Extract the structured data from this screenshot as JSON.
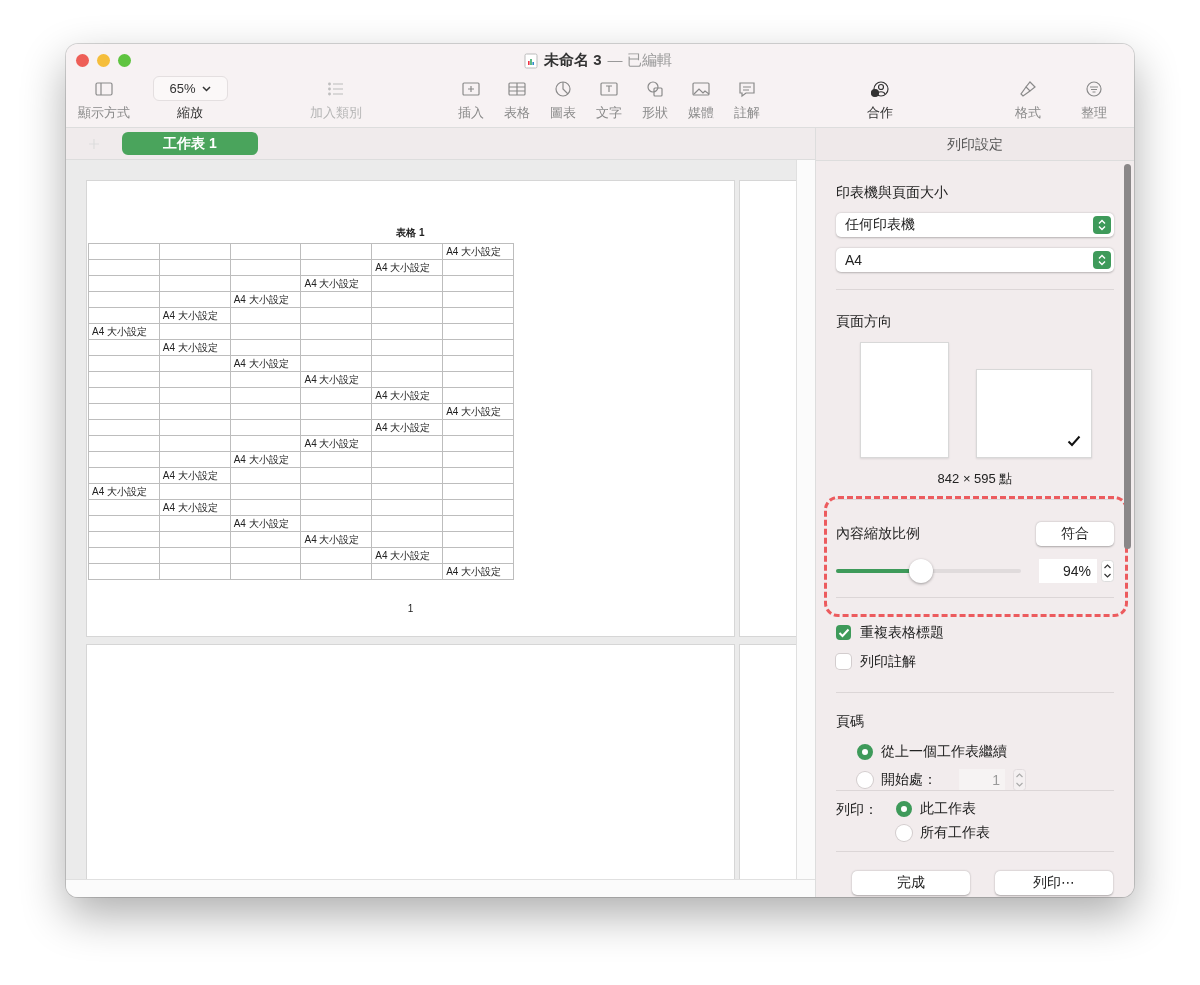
{
  "window": {
    "title": "未命名 3",
    "status": "— 已編輯"
  },
  "toolbar": {
    "groups": [
      {
        "items": [
          {
            "kind": "view",
            "label": "顯示方式"
          },
          {
            "kind": "zoom",
            "label": "縮放",
            "value": "65%"
          }
        ]
      },
      {
        "items": [
          {
            "kind": "category",
            "label": "加入類別",
            "disabled": true
          }
        ]
      },
      {
        "items": [
          {
            "kind": "insert",
            "label": "插入"
          },
          {
            "kind": "table",
            "label": "表格"
          },
          {
            "kind": "chart",
            "label": "圖表"
          },
          {
            "kind": "text",
            "label": "文字"
          },
          {
            "kind": "shape",
            "label": "形狀"
          },
          {
            "kind": "media",
            "label": "媒體"
          },
          {
            "kind": "comment",
            "label": "註解"
          }
        ]
      },
      {
        "items": [
          {
            "kind": "collaborate",
            "label": "合作"
          }
        ]
      },
      {
        "items": [
          {
            "kind": "format",
            "label": "格式"
          },
          {
            "kind": "organize",
            "label": "整理"
          }
        ]
      }
    ]
  },
  "sheet_tabs": [
    {
      "label": "工作表 1",
      "selected": true
    }
  ],
  "page": {
    "table_title": "表格 1",
    "page_number": "1",
    "rows": [
      {
        "cells": [
          null,
          null,
          null,
          null,
          null,
          "A4 大小設定"
        ]
      },
      {
        "cells": [
          null,
          null,
          null,
          null,
          "A4 大小設定",
          null
        ]
      },
      {
        "cells": [
          null,
          null,
          null,
          "A4 大小設定",
          null,
          null
        ]
      },
      {
        "cells": [
          null,
          null,
          "A4 大小設定",
          null,
          null,
          null
        ]
      },
      {
        "cells": [
          null,
          "A4 大小設定",
          null,
          null,
          null,
          null
        ]
      },
      {
        "cells": [
          "A4 大小設定",
          null,
          null,
          null,
          null,
          null
        ]
      },
      {
        "cells": [
          null,
          "A4 大小設定",
          null,
          null,
          null,
          null
        ]
      },
      {
        "cells": [
          null,
          null,
          "A4 大小設定",
          null,
          null,
          null
        ]
      },
      {
        "cells": [
          null,
          null,
          null,
          "A4 大小設定",
          null,
          null
        ]
      },
      {
        "cells": [
          null,
          null,
          null,
          null,
          "A4 大小設定",
          null
        ]
      },
      {
        "cells": [
          null,
          null,
          null,
          null,
          null,
          "A4 大小設定"
        ]
      },
      {
        "cells": [
          null,
          null,
          null,
          null,
          "A4 大小設定",
          null
        ]
      },
      {
        "cells": [
          null,
          null,
          null,
          "A4 大小設定",
          null,
          null
        ]
      },
      {
        "cells": [
          null,
          null,
          "A4 大小設定",
          null,
          null,
          null
        ]
      },
      {
        "cells": [
          null,
          "A4 大小設定",
          null,
          null,
          null,
          null
        ]
      },
      {
        "cells": [
          "A4 大小設定",
          null,
          null,
          null,
          null,
          null
        ]
      },
      {
        "cells": [
          null,
          "A4 大小設定",
          null,
          null,
          null,
          null
        ]
      },
      {
        "cells": [
          null,
          null,
          "A4 大小設定",
          null,
          null,
          null
        ]
      },
      {
        "cells": [
          null,
          null,
          null,
          "A4 大小設定",
          null,
          null
        ]
      },
      {
        "cells": [
          null,
          null,
          null,
          null,
          "A4 大小設定",
          null
        ]
      },
      {
        "cells": [
          null,
          null,
          null,
          null,
          null,
          "A4 大小設定"
        ]
      }
    ]
  },
  "print_settings": {
    "title": "列印設定",
    "printer_section": {
      "title": "印表機與頁面大小",
      "printer": "任何印表機",
      "paper_size": "A4"
    },
    "orientation": {
      "title": "頁面方向",
      "options": [
        {
          "kind": "portrait",
          "selected": false
        },
        {
          "kind": "landscape",
          "selected": true
        }
      ],
      "dimensions": "842 × 595 點"
    },
    "scale": {
      "title": "內容縮放比例",
      "fit_button": "符合",
      "level": 0.46,
      "value": "94%"
    },
    "checkboxes": [
      {
        "label": "重複表格標題",
        "checked": true
      },
      {
        "label": "列印註解",
        "checked": false
      }
    ],
    "page_numbers": {
      "title": "頁碼",
      "options": [
        {
          "label": "從上一個工作表繼續",
          "selected": true
        },
        {
          "label": "開始處：",
          "selected": false,
          "field": "1"
        }
      ]
    },
    "print_scope": {
      "label": "列印：",
      "options": [
        {
          "label": "此工作表",
          "selected": true
        },
        {
          "label": "所有工作表",
          "selected": false
        }
      ]
    },
    "buttons": [
      "完成",
      "列印⋯"
    ]
  }
}
